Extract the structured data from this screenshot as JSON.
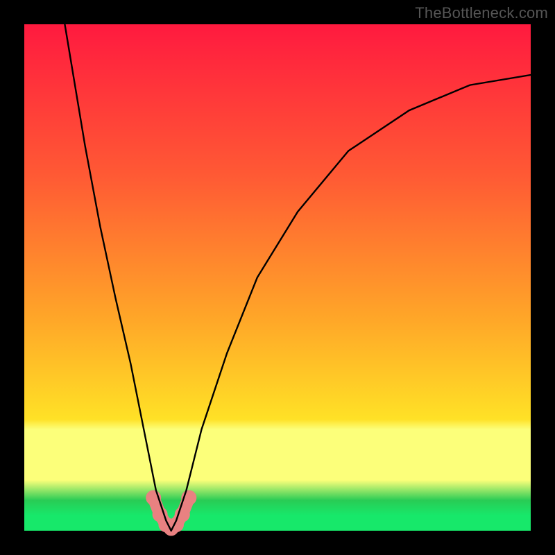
{
  "watermark": "TheBottleneck.com",
  "colors": {
    "top": "#ff1a3f",
    "upper": "#ff5a34",
    "mid": "#ffa628",
    "yellow": "#ffe126",
    "pale": "#fcff7a",
    "greenDark": "#29cc55",
    "green": "#17e86a",
    "bump": "#e98181",
    "curve": "#000000"
  },
  "chart_data": {
    "type": "line",
    "title": "",
    "xlabel": "",
    "ylabel": "",
    "xlim": [
      0,
      100
    ],
    "ylim": [
      0,
      100
    ],
    "notch_x": 29,
    "series": [
      {
        "name": "bottleneck-curve",
        "x": [
          8,
          10,
          12,
          15,
          18,
          21,
          24,
          26,
          28,
          29,
          30,
          32,
          35,
          40,
          46,
          54,
          64,
          76,
          88,
          100
        ],
        "y": [
          100,
          88,
          76,
          60,
          46,
          33,
          18,
          8,
          2,
          0,
          2,
          8,
          20,
          35,
          50,
          63,
          75,
          83,
          88,
          90
        ]
      }
    ],
    "bump": {
      "name": "highlight-dots",
      "x": [
        25.5,
        26.8,
        28,
        29,
        30,
        31.2,
        32.5
      ],
      "y": [
        6.5,
        3.2,
        1.2,
        0.5,
        1.2,
        3.2,
        6.5
      ]
    }
  }
}
